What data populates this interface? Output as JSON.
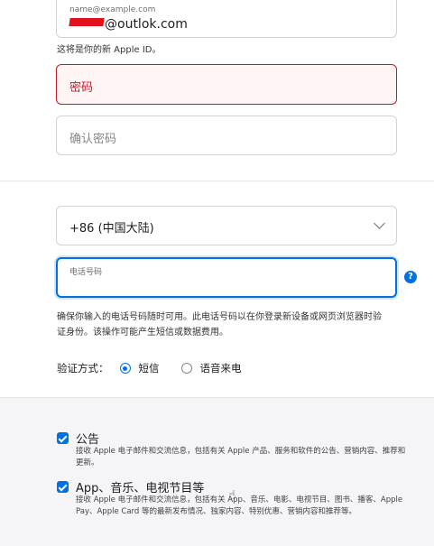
{
  "apple_id": {
    "label": "name@example.com",
    "value_suffix": "@outlok.com",
    "helper": "这将是你的新 Apple ID。"
  },
  "password": {
    "placeholder": "密码",
    "error_color": "#c8192a"
  },
  "confirm_password": {
    "placeholder": "确认密码"
  },
  "phone": {
    "country_value": "+86 (中国大陆)",
    "number_label": "电话号码",
    "info_icon": "?",
    "description": "确保你输入的电话号码随时可用。此电话号码以在你登录新设备或网页浏览器时验证身份。该操作可能产生短信或数据费用。"
  },
  "verification": {
    "label": "验证方式：",
    "options": [
      {
        "label": "短信",
        "selected": true
      },
      {
        "label": "语音来电",
        "selected": false
      }
    ]
  },
  "subscriptions": [
    {
      "title": "公告",
      "description": "接收 Apple 电子邮件和交流信息，包括有关 Apple 产品、服务和软件的公告、营销内容、推荐和更新。",
      "checked": true
    },
    {
      "title": "App、音乐、电视节目等",
      "description": "接收 Apple 电子邮件和交流信息，包括有关 App、音乐、电影、电视节目、图书、播客、Apple Pay、Apple Card 等的最新发布情况、独家内容、特别优惠、营销内容和推荐等。",
      "checked": true
    }
  ],
  "colors": {
    "accent": "#0071e3",
    "error": "#c8192a",
    "section_bg": "#f5f5f7"
  },
  "icons": [
    "chevron-down-icon",
    "info-icon",
    "radio-icon",
    "checkbox-icon",
    "hand-cursor-icon"
  ]
}
